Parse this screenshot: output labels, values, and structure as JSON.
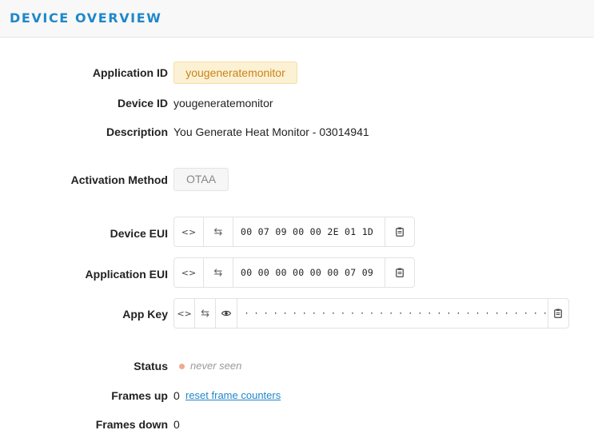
{
  "header": {
    "title": "DEVICE OVERVIEW"
  },
  "fields": {
    "application_id": {
      "label": "Application ID",
      "value": "yougeneratemonitor"
    },
    "device_id": {
      "label": "Device ID",
      "value": "yougeneratemonitor"
    },
    "description": {
      "label": "Description",
      "value": "You Generate Heat Monitor - 03014941"
    },
    "activation_method": {
      "label": "Activation Method",
      "value": "OTAA"
    },
    "device_eui": {
      "label": "Device EUI",
      "value": "00 07 09 00 00 2E 01 1D"
    },
    "application_eui": {
      "label": "Application EUI",
      "value": "00 00 00 00 00 00 07 09"
    },
    "app_key": {
      "label": "App Key",
      "value": "· · · · · · · · · · · · · · · · · · · · · · · · · · · · · · · ·"
    },
    "status": {
      "label": "Status",
      "value": "never seen",
      "dot_color": "#f2a98f"
    },
    "frames_up": {
      "label": "Frames up",
      "value": "0",
      "link": "reset frame counters"
    },
    "frames_down": {
      "label": "Frames down",
      "value": "0"
    }
  },
  "icons": {
    "code": "<>",
    "swap": "⇆",
    "eye": "eye-icon",
    "copy": "clipboard-icon"
  },
  "colors": {
    "accent": "#1f87c9",
    "app_badge_bg": "#fdf1d4",
    "app_badge_text": "#c8831a"
  }
}
